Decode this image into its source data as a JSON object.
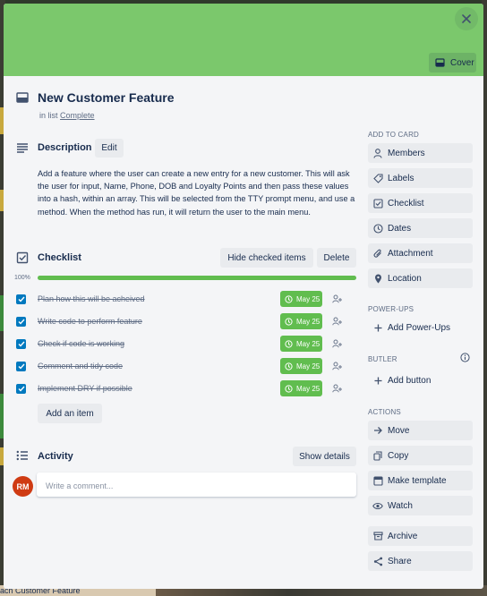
{
  "card": {
    "title": "New Customer Feature",
    "in_list_prefix": "in list",
    "list_name": "Complete",
    "cover_label": "Cover"
  },
  "colors": {
    "cover": "#7bc86c",
    "checkbox": "#0079bf",
    "due_complete": "#61bd4f",
    "progress_fill": "#61bd4f",
    "avatar": "#cf3b13"
  },
  "description": {
    "heading": "Description",
    "edit_label": "Edit",
    "text": "Add a feature where the user can create a new entry for a new customer. This will ask the user for input, Name, Phone, DOB and Loyalty Points and then pass these values into a hash, within an array. This will be selected from the TTY prompt menu, and use a method. When the method has run, it will return the user to the main menu."
  },
  "checklist": {
    "heading": "Checklist",
    "hide_checked_label": "Hide checked items",
    "delete_label": "Delete",
    "progress_text": "100%",
    "progress_fraction": 1.0,
    "items": [
      {
        "text": "Plan how this will be acheived",
        "due": "May 25",
        "checked": true
      },
      {
        "text": "Write code to perform feature",
        "due": "May 25",
        "checked": true
      },
      {
        "text": "Check if code is working",
        "due": "May 25",
        "checked": true
      },
      {
        "text": "Comment and tidy code",
        "due": "May 25",
        "checked": true
      },
      {
        "text": "Implement DRY if possible",
        "due": "May 25",
        "checked": true
      }
    ],
    "add_item_label": "Add an item"
  },
  "activity": {
    "heading": "Activity",
    "show_details_label": "Show details",
    "avatar_initials": "RM",
    "comment_placeholder": "Write a comment..."
  },
  "sidebar": {
    "add_to_card_heading": "ADD TO CARD",
    "add_to_card": [
      {
        "label": "Members",
        "icon": "person-icon"
      },
      {
        "label": "Labels",
        "icon": "tag-icon"
      },
      {
        "label": "Checklist",
        "icon": "checklist-icon"
      },
      {
        "label": "Dates",
        "icon": "clock-icon"
      },
      {
        "label": "Attachment",
        "icon": "paperclip-icon"
      },
      {
        "label": "Location",
        "icon": "pin-icon"
      }
    ],
    "power_ups_heading": "POWER-UPS",
    "add_power_ups_label": "Add Power-Ups",
    "butler_heading": "BUTLER",
    "add_button_label": "Add button",
    "actions_heading": "ACTIONS",
    "actions": [
      {
        "label": "Move",
        "icon": "arrow-right-icon"
      },
      {
        "label": "Copy",
        "icon": "copy-icon"
      },
      {
        "label": "Make template",
        "icon": "template-icon"
      },
      {
        "label": "Watch",
        "icon": "eye-icon"
      },
      {
        "label": "Archive",
        "icon": "archive-icon"
      },
      {
        "label": "Share",
        "icon": "share-icon"
      }
    ]
  },
  "background": {
    "peek_text": "ach Customer Feature"
  }
}
